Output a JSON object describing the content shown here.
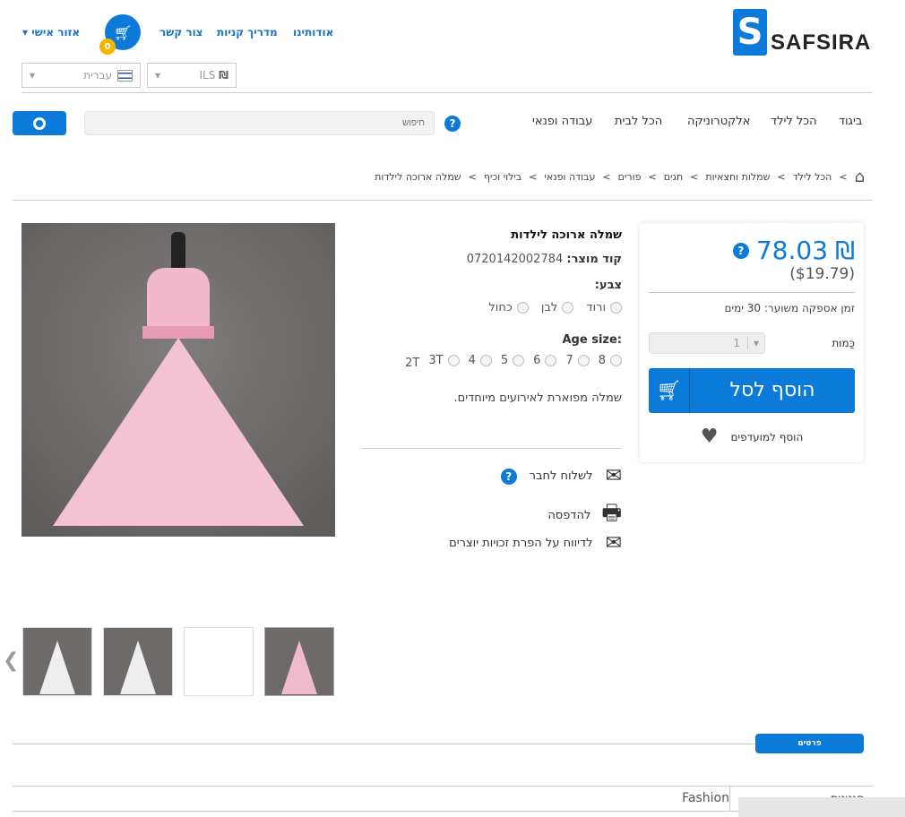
{
  "header": {
    "logo": "SAFSIRA",
    "links": [
      "אודותינו",
      "מדריך קניות",
      "צור קשר"
    ],
    "cart_count": "0",
    "account": "אזור אישי ▾",
    "currency": "ILS",
    "currency_symbol": "₪",
    "language": "עברית"
  },
  "nav": {
    "items": [
      "ביגוד",
      "הכל לילד",
      "אלקטרוניקה",
      "הכל לבית",
      "עבודה ופנאי"
    ],
    "search_placeholder": "חיפוש",
    "help": "?"
  },
  "breadcrumb": [
    "הכל לילד",
    "שמלות וחצאיות",
    "חגים",
    "פורים",
    "עבודה ופנאי",
    "בילוי וכיף",
    "שמלה ארוכה לילדות"
  ],
  "product": {
    "title": "שמלה ארוכה לילדות",
    "code_label": "קוד מוצר:",
    "code": "0720142002784",
    "color_label": "צבע:",
    "colors": [
      "ורוד",
      "לבן",
      "כחול"
    ],
    "size_label": "Age size:",
    "sizes": [
      "8",
      "7",
      "6",
      "5",
      "4",
      "3T",
      "2T"
    ],
    "description": "שמלה מפוארת לאירועים מיוחדים.",
    "actions": [
      "לשלוח לחבר",
      "להדפסה",
      "לדיווח על הפרת זכויות יוצרים"
    ]
  },
  "buy": {
    "price": "78.03",
    "currency_symbol": "₪",
    "usd_price": "($19.79)",
    "delivery": "זמן אספקה משוער: 30 ימים",
    "qty_label": "כַּמוּת",
    "qty": "1",
    "add_to_cart": "הוסף לסל",
    "wishlist": "הוסף למועדפים"
  },
  "tabs": {
    "details": "פרטים"
  },
  "specs": [
    {
      "name": "סגנונות",
      "value": "Fashion"
    }
  ],
  "colors": {
    "accent": "#0b7ad8",
    "text": "#333333"
  }
}
